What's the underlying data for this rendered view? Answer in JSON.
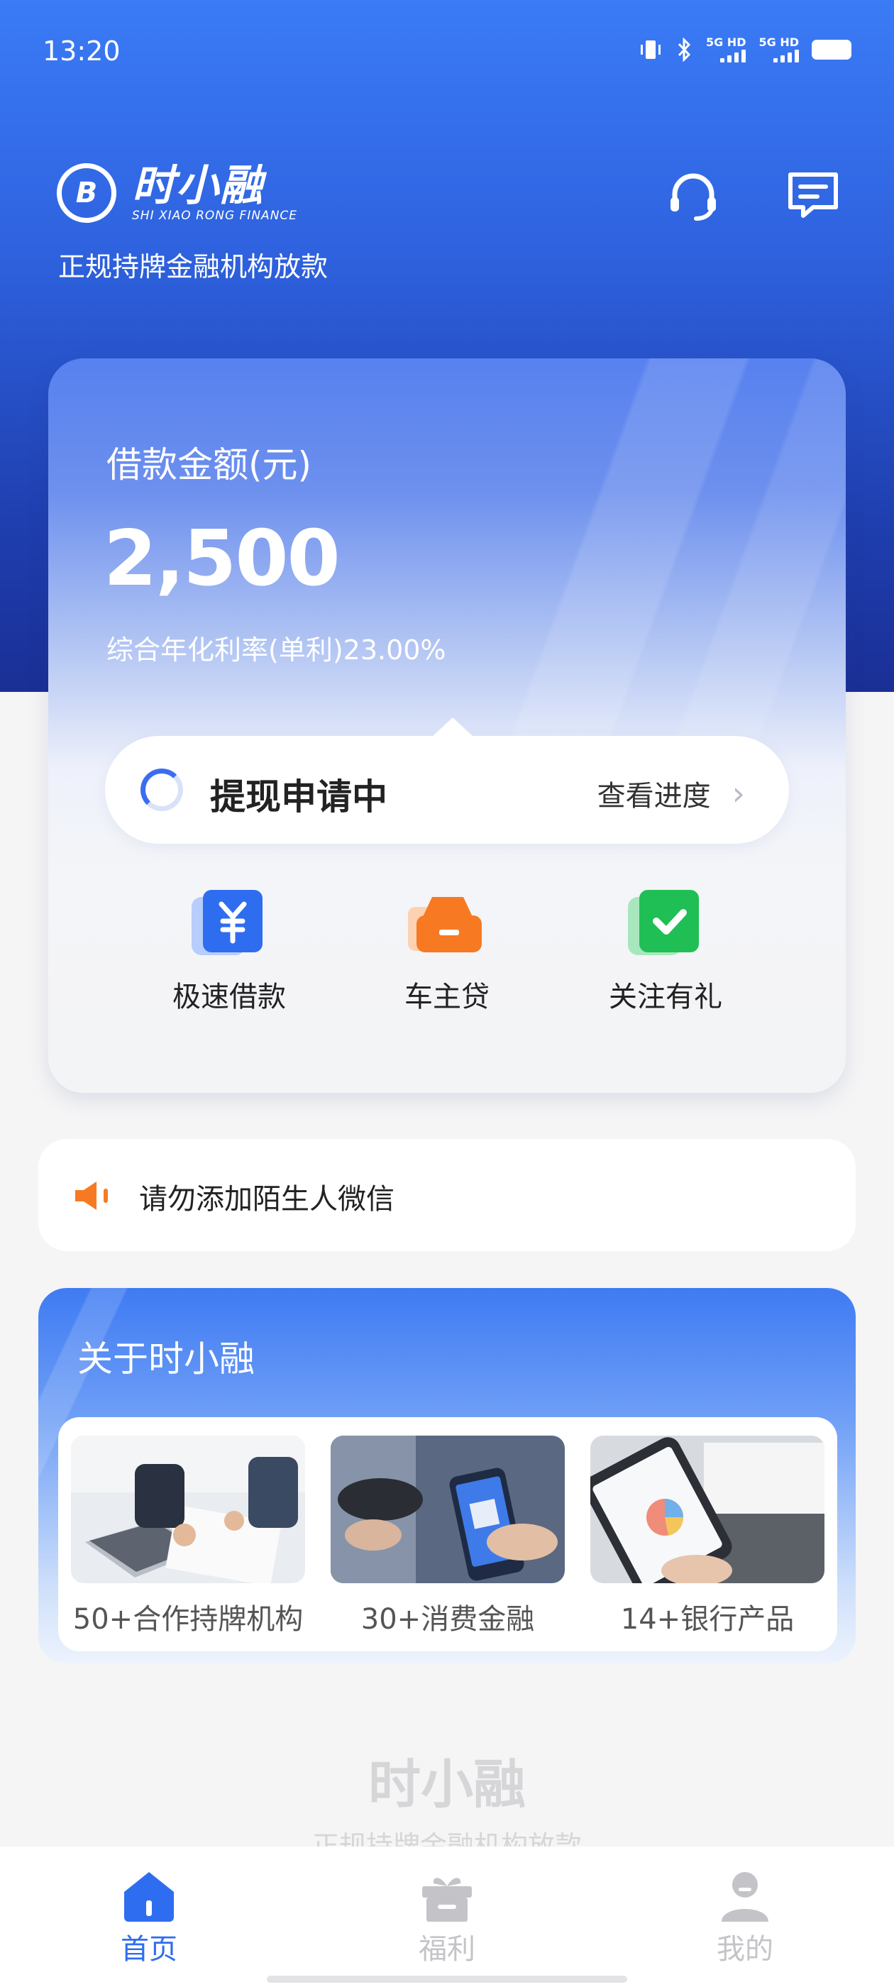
{
  "status_bar": {
    "time": "13:20",
    "sim1": "5G HD",
    "sim2": "5G HD"
  },
  "header": {
    "brand_mark": "B",
    "brand_name": "时小融",
    "brand_sub": "SHI XIAO RONG FINANCE",
    "tagline": "正规持牌金融机构放款",
    "icons": [
      "headset-icon",
      "message-icon"
    ]
  },
  "loan_card": {
    "amount_label": "借款金额(元)",
    "amount_value": "2,500",
    "rate_text": "综合年化利率(单利)23.00%",
    "status_text": "提现申请中",
    "progress_link": "查看进度",
    "quick_actions": [
      {
        "label": "极速借款",
        "icon": "yuan-icon",
        "color": "#2f6df0"
      },
      {
        "label": "车主贷",
        "icon": "car-icon",
        "color": "#f77a22"
      },
      {
        "label": "关注有礼",
        "icon": "check-icon",
        "color": "#1fbf55"
      }
    ]
  },
  "notice": {
    "text": "请勿添加陌生人微信",
    "icon": "speaker-icon",
    "icon_color": "#f77a22"
  },
  "about": {
    "title": "关于时小融",
    "items": [
      {
        "label": "50+合作持牌机构"
      },
      {
        "label": "30+消费金融"
      },
      {
        "label": "14+银行产品"
      }
    ]
  },
  "footer": {
    "brand": "时小融",
    "tagline": "正规持牌金融机构放款"
  },
  "tabbar": {
    "tabs": [
      {
        "label": "首页",
        "icon": "home-icon",
        "active": true
      },
      {
        "label": "福利",
        "icon": "gift-icon",
        "active": false
      },
      {
        "label": "我的",
        "icon": "user-icon",
        "active": false
      }
    ],
    "active_color": "#2f6df0",
    "inactive_color": "#c4c4c8"
  }
}
